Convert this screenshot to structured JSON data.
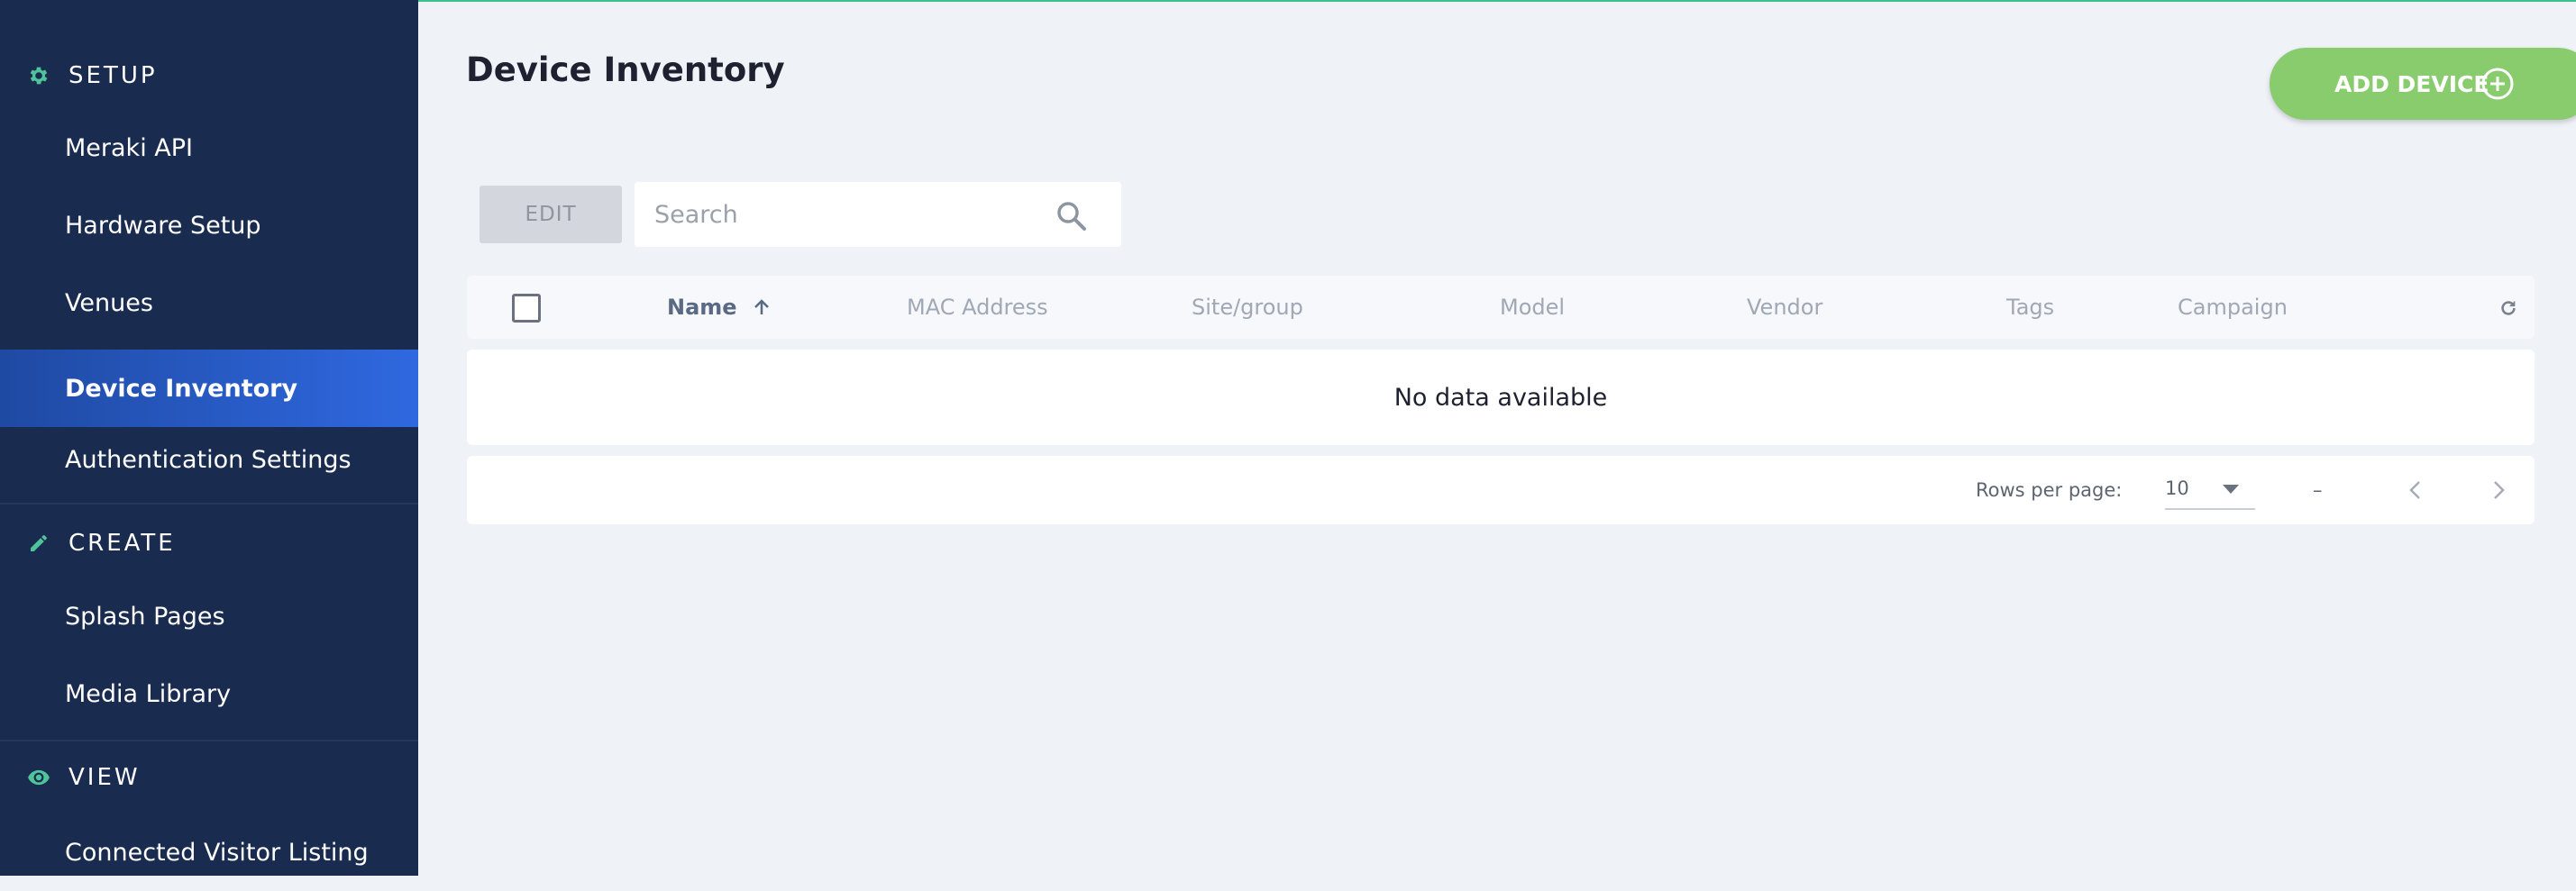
{
  "sidebar": {
    "sections": [
      {
        "label": "SETUP",
        "icon": "gear-icon",
        "items": [
          "Meraki API",
          "Hardware Setup",
          "Venues",
          "Device Inventory",
          "Authentication Settings"
        ]
      },
      {
        "label": "CREATE",
        "icon": "pencil-icon",
        "items": [
          "Splash Pages",
          "Media Library"
        ]
      },
      {
        "label": "VIEW",
        "icon": "eye-icon",
        "items": [
          "Connected Visitor Listing"
        ]
      }
    ],
    "active_item": "Device Inventory"
  },
  "page": {
    "title": "Device Inventory",
    "add_button_label": "ADD DEVICE"
  },
  "toolbar": {
    "edit_label": "EDIT",
    "search_placeholder": "Search"
  },
  "table": {
    "columns": [
      "Name",
      "MAC Address",
      "Site/group",
      "Model",
      "Vendor",
      "Tags",
      "Campaign"
    ],
    "sorted_column": "Name",
    "empty_text": "No data available"
  },
  "pagination": {
    "rows_per_page_label": "Rows per page:",
    "rows_per_page_value": "10",
    "range_text": "–"
  },
  "colors": {
    "sidebar_bg": "#192b4f",
    "active_nav": "#2f68e0",
    "accent_green": "#88cc6e",
    "section_icon": "#4fc39a",
    "page_bg": "#eff2f7"
  }
}
